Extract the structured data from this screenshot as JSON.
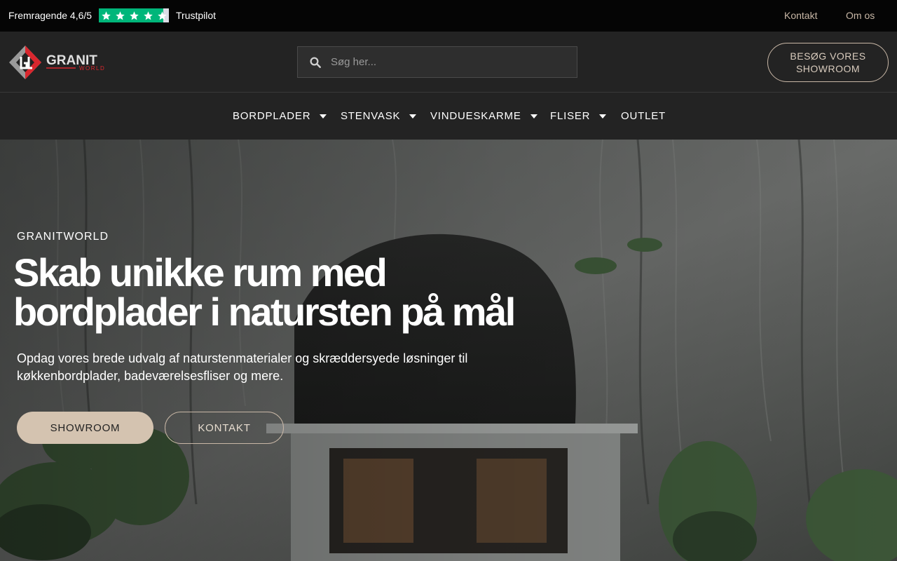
{
  "topbar": {
    "rating_text": "Fremragende 4,6/5",
    "rating_value": 4.6,
    "rating_max": 5,
    "provider": "Trustpilot",
    "star_color": "#00b67a",
    "links": [
      {
        "label": "Kontakt"
      },
      {
        "label": "Om os"
      }
    ]
  },
  "header": {
    "logo": {
      "name": "GRANIT",
      "sub": "WORLD"
    },
    "search": {
      "placeholder": "Søg her..."
    },
    "showroom_button": {
      "line1": "BESØG VORES",
      "line2": "SHOWROOM"
    }
  },
  "nav": {
    "items": [
      {
        "label": "BORDPLADER",
        "has_dropdown": true
      },
      {
        "label": "STENVASK",
        "has_dropdown": true
      },
      {
        "label": "VINDUESKARME",
        "has_dropdown": true
      },
      {
        "label": "FLISER",
        "has_dropdown": true
      },
      {
        "label": "OUTLET",
        "has_dropdown": false
      }
    ]
  },
  "hero": {
    "eyebrow": "GRANITWORLD",
    "title_line1": "Skab unikke rum med",
    "title_line2": "bordplader i natursten på mål",
    "description_line1": "Opdag vores brede udvalg af naturstenmaterialer og skræddersyede løsninger til",
    "description_line2": "køkkenbordplader, badeværelsesfliser og mere.",
    "primary_cta": "SHOWROOM",
    "secondary_cta": "KONTAKT"
  },
  "colors": {
    "accent": "#d4c3b0",
    "accent_border": "#c8b7a6",
    "header_bg": "#232323",
    "topbar_bg": "#050505",
    "logo_red": "#d9272e"
  }
}
